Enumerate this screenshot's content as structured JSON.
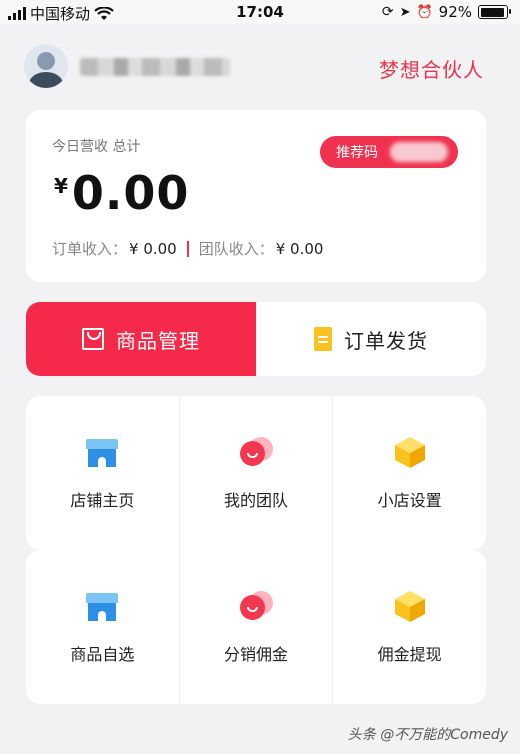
{
  "status_bar": {
    "carrier": "中国移动",
    "time": "17:04",
    "battery": "92%",
    "battery_level": 0.92
  },
  "header": {
    "partner_label": "梦想合伙人"
  },
  "revenue": {
    "label": "今日营收 总计",
    "currency": "¥",
    "amount": "0.00",
    "order_income_label": "订单收入：",
    "order_income_value": "¥ 0.00",
    "team_income_label": "团队收入：",
    "team_income_value": "¥ 0.00",
    "referral_label": "推荐码"
  },
  "tabs": [
    {
      "label": "商品管理",
      "icon": "shopping-bag-icon",
      "active": true
    },
    {
      "label": "订单发货",
      "icon": "document-icon",
      "active": false
    }
  ],
  "grid": [
    {
      "label": "店铺主页",
      "icon": "store-icon"
    },
    {
      "label": "我的团队",
      "icon": "team-icon"
    },
    {
      "label": "小店设置",
      "icon": "box-icon"
    },
    {
      "label": "商品自选",
      "icon": "store-icon"
    },
    {
      "label": "分销佣金",
      "icon": "team-icon"
    },
    {
      "label": "佣金提现",
      "icon": "box-icon"
    }
  ],
  "watermark": "头条 @不万能的Comedy",
  "colors": {
    "accent": "#f5294a",
    "partner": "#e8344e",
    "store_blue": "#2d8fe6",
    "box_yellow": "#f9c21c"
  }
}
